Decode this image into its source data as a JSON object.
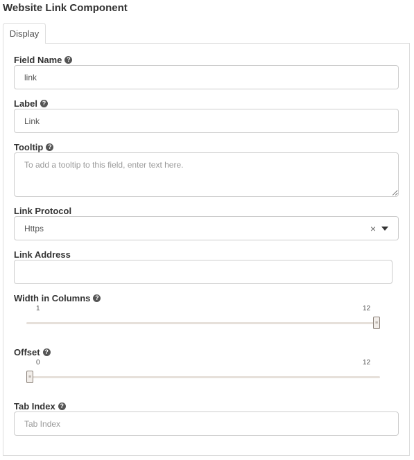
{
  "title": "Website Link Component",
  "tabs": [
    {
      "label": "Display"
    }
  ],
  "fields": {
    "field_name": {
      "label": "Field Name",
      "value": "link"
    },
    "label": {
      "label": "Label",
      "value": "Link"
    },
    "tooltip": {
      "label": "Tooltip",
      "placeholder": "To add a tooltip to this field, enter text here."
    },
    "link_protocol": {
      "label": "Link Protocol",
      "value": "Https"
    },
    "link_address": {
      "label": "Link Address",
      "value": ""
    },
    "width_in_columns": {
      "label": "Width in Columns",
      "min": "1",
      "max": "12",
      "value": 12
    },
    "offset": {
      "label": "Offset",
      "min": "0",
      "max": "12",
      "value": 0
    },
    "tab_index": {
      "label": "Tab Index",
      "placeholder": "Tab Index"
    }
  }
}
